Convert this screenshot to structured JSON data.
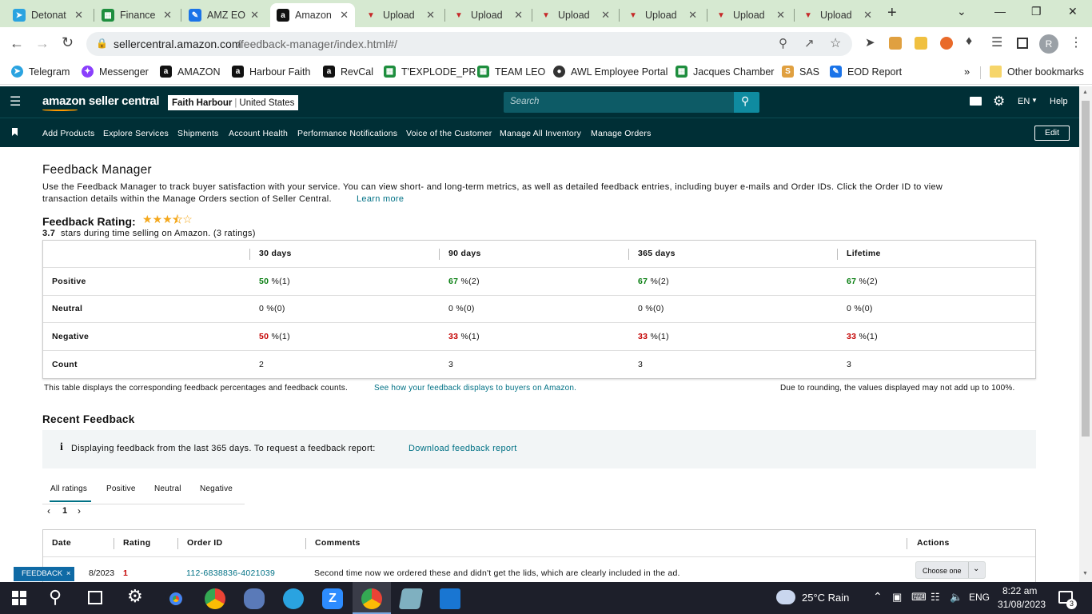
{
  "browser": {
    "tabs": [
      {
        "label": "Detonat",
        "icon": "telegram-icon",
        "color": "#2aa3e0",
        "active": false
      },
      {
        "label": "Finance",
        "icon": "sheets-icon",
        "color": "#1e8e3e",
        "active": false
      },
      {
        "label": "AMZ EO",
        "icon": "pen-icon",
        "color": "#1a73e8",
        "active": false
      },
      {
        "label": "Amazon",
        "icon": "amazon-icon",
        "color": "#111111",
        "active": true
      },
      {
        "label": "Upload",
        "icon": "upload-icon",
        "color": "#c62828",
        "active": false
      },
      {
        "label": "Upload",
        "icon": "upload-icon",
        "color": "#c62828",
        "active": false
      },
      {
        "label": "Upload",
        "icon": "upload-icon",
        "color": "#c62828",
        "active": false
      },
      {
        "label": "Upload",
        "icon": "upload-icon",
        "color": "#c62828",
        "active": false
      },
      {
        "label": "Upload",
        "icon": "upload-icon",
        "color": "#c62828",
        "active": false
      },
      {
        "label": "Upload",
        "icon": "upload-icon",
        "color": "#c62828",
        "active": false
      }
    ],
    "url_host": "sellercentral.amazon.com",
    "url_path": "/feedback-manager/index.html#/",
    "profile_initial": "R",
    "bookmarks": [
      {
        "label": "Telegram",
        "icon": "telegram-icon",
        "color": "#2aa3e0"
      },
      {
        "label": "Messenger",
        "icon": "messenger-icon",
        "color": "#8a3ffc"
      },
      {
        "label": "AMAZON",
        "icon": "amazon-icon",
        "color": "#ffffff"
      },
      {
        "label": "Harbour Faith",
        "icon": "amazon-icon",
        "color": "#111111"
      },
      {
        "label": "RevCal",
        "icon": "amazon-icon",
        "color": "#111111"
      },
      {
        "label": "T'EXPLODE_PR",
        "icon": "sheets-icon",
        "color": "#1e8e3e"
      },
      {
        "label": "TEAM LEO",
        "icon": "sheets-icon",
        "color": "#1e8e3e"
      },
      {
        "label": "AWL Employee Portal",
        "icon": "globe-icon",
        "color": "#333333"
      },
      {
        "label": "Jacques Chamber",
        "icon": "sheets-icon",
        "color": "#1e8e3e"
      },
      {
        "label": "SAS",
        "icon": "sas-icon",
        "color": "#e0a040"
      },
      {
        "label": "EOD Report",
        "icon": "pen-icon",
        "color": "#1a73e8"
      }
    ],
    "bookmarks_more": "»",
    "other_bookmarks": "Other bookmarks"
  },
  "header": {
    "logo": "amazon seller central",
    "store_name": "Faith Harbour",
    "marketplace": "United States",
    "search_placeholder": "Search",
    "language": "EN",
    "help": "Help"
  },
  "nav": {
    "items": [
      "Add Products",
      "Explore Services",
      "Shipments",
      "Account Health",
      "Performance Notifications",
      "Voice of the Customer",
      "Manage All Inventory",
      "Manage Orders"
    ],
    "edit": "Edit"
  },
  "page": {
    "title": "Feedback Manager",
    "intro_line1": "Use the Feedback Manager to track buyer satisfaction with your service. You can view short- and long-term metrics, as well as detailed feedback entries, including buyer e-mails and Order IDs. Click the Order ID to view",
    "intro_line2": "transaction details within the Manage Orders section of Seller Central.",
    "learn_more": "Learn more",
    "rating_label": "Feedback Rating:",
    "rating_stars": 3.5,
    "rating_value": "3.7",
    "rating_text": "stars during time selling on Amazon. (3 ratings)"
  },
  "summary_table": {
    "columns": [
      "30 days",
      "90 days",
      "365 days",
      "Lifetime"
    ],
    "rows": [
      {
        "label": "Positive",
        "kind": "positive",
        "cells": [
          [
            "50",
            " %(1)"
          ],
          [
            "67",
            " %(2)"
          ],
          [
            "67",
            " %(2)"
          ],
          [
            "67",
            " %(2)"
          ]
        ]
      },
      {
        "label": "Neutral",
        "kind": "neutral",
        "cells": [
          [
            "0",
            " %(0)"
          ],
          [
            "0",
            " %(0)"
          ],
          [
            "0",
            " %(0)"
          ],
          [
            "0",
            " %(0)"
          ]
        ]
      },
      {
        "label": "Negative",
        "kind": "negative",
        "cells": [
          [
            "50",
            " %(1)"
          ],
          [
            "33",
            " %(1)"
          ],
          [
            "33",
            " %(1)"
          ],
          [
            "33",
            " %(1)"
          ]
        ]
      },
      {
        "label": "Count",
        "kind": "count",
        "cells": [
          [
            "2",
            ""
          ],
          [
            "3",
            ""
          ],
          [
            "3",
            ""
          ],
          [
            "3",
            ""
          ]
        ]
      }
    ],
    "footnote": "This table displays the corresponding feedback percentages and feedback counts.",
    "footnote_link": "See how your feedback displays to buyers on Amazon.",
    "rounding_note": "Due to rounding, the values displayed may not add up to 100%."
  },
  "recent": {
    "title": "Recent Feedback",
    "info_text": "Displaying feedback from the last 365 days. To request a feedback report:",
    "info_link": "Download feedback report",
    "tabs": [
      "All ratings",
      "Positive",
      "Neutral",
      "Negative"
    ],
    "page": "1",
    "columns": [
      "Date",
      "Rating",
      "Order ID",
      "Comments",
      "Actions"
    ],
    "rows": [
      {
        "date": "8/2023",
        "rating": "1",
        "order_id": "112-6838836-4021039",
        "comment": "Second time now we ordered these and didn't get the lids, which are clearly included in the ad.",
        "action": "Choose one"
      }
    ],
    "feedback_tag": "FEEDBACK"
  },
  "taskbar": {
    "weather": "25°C  Rain",
    "lang": "ENG",
    "time": "8:22 am",
    "date": "31/08/2023",
    "notifications": "3"
  }
}
